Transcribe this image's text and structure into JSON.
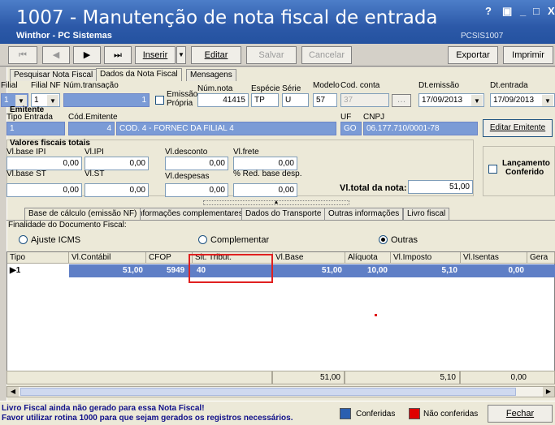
{
  "window": {
    "title": "1007 - Manutenção de nota fiscal de entrada",
    "company": "Winthor - PC Sistemas",
    "routine": "PCSIS1007",
    "controls": [
      "?",
      "▣",
      "_",
      "□",
      "X"
    ]
  },
  "toolbar": {
    "insert": "Inserir",
    "edit": "Editar",
    "save": "Salvar",
    "cancel": "Cancelar",
    "export": "Exportar",
    "print": "Imprimir"
  },
  "tabs": {
    "search": "Pesquisar Nota Fiscal",
    "data": "Dados da Nota Fiscal",
    "messages": "Mensagens"
  },
  "header": {
    "filial_label": "Filial",
    "filial_value": "1",
    "filial_nf_label": "Filial NF",
    "filial_nf_value": "1",
    "transacao_label": "Núm.transação",
    "transacao_value": "1",
    "emissao_propria_label_1": "Emissão",
    "emissao_propria_label_2": "Própria",
    "num_nota_label": "Núm.nota",
    "num_nota_value": "41415",
    "especie_label": "Espécie",
    "especie_value": "TP",
    "serie_label": "Série",
    "serie_value": "U",
    "modelo_label": "Modelo",
    "modelo_value": "57",
    "cod_conta_label": "Cod. conta",
    "cod_conta_value": "37",
    "dt_emissao_label": "Dt.emissão",
    "dt_emissao_value": "17/09/2013",
    "dt_entrada_label": "Dt.entrada",
    "dt_entrada_value": "17/09/2013"
  },
  "emitente": {
    "section": "Emitente",
    "tipo_entrada_label": "Tipo Entrada",
    "tipo_entrada_value": "1",
    "cod_label": "Cód.Emitente",
    "cod_value": "4",
    "nome_value": "COD. 4 - FORNEC DA FILIAL 4",
    "uf_label": "UF",
    "uf_value": "GO",
    "cnpj_label": "CNPJ",
    "cnpj_value": "06.177.710/0001-78",
    "edit_button": "Editar Emitente"
  },
  "valores": {
    "section": "Valores fiscais totais",
    "base_ipi_label": "Vl.base IPI",
    "base_ipi_value": "0,00",
    "ipi_label": "Vl.IPI",
    "ipi_value": "0,00",
    "desconto_label": "Vl.desconto",
    "desconto_value": "0,00",
    "frete_label": "Vl.frete",
    "frete_value": "0,00",
    "base_st_label": "Vl.base ST",
    "base_st_value": "0,00",
    "st_label": "Vl.ST",
    "st_value": "0,00",
    "despesas_label": "Vl.despesas",
    "despesas_value": "0,00",
    "red_base_label": "% Red. base desp.",
    "red_base_value": "0,00",
    "total_label": "Vl.total da nota:",
    "total_value": "51,00",
    "lancamento_1": "Lançamento",
    "lancamento_2": "Conferido"
  },
  "subtabs": {
    "base": "Base de cálculo (emissão NF)",
    "info": "Informações complementares",
    "transporte": "Dados do Transporte",
    "outras": "Outras informações",
    "livro": "Livro fiscal"
  },
  "finalidade": {
    "label": "Finalidade do Documento Fiscal:",
    "ajuste": "Ajuste ICMS",
    "complementar": "Complementar",
    "outras": "Outras"
  },
  "grid": {
    "headers": [
      "Tipo",
      "Vl.Contábil",
      "CFOP",
      "Sit. Tribut.",
      "Vl.Base",
      "Alíquota",
      "Vl.Imposto",
      "Vl.Isentas",
      "Gera"
    ],
    "row": {
      "tipo": "1",
      "contabil": "51,00",
      "cfop": "5949",
      "sit": "40",
      "base": "51,00",
      "aliquota": "10,00",
      "imposto": "5,10",
      "isentas": "0,00"
    },
    "footer": {
      "base": "51,00",
      "imposto": "5,10",
      "isentas": "0,00"
    }
  },
  "status": {
    "line1": "Livro Fiscal ainda não gerado para essa Nota Fiscal!",
    "line2": "Favor utilizar rotina 1000 para que sejam gerados os registros necessários.",
    "conferidas": "Conferidas",
    "nao_conferidas": "Não conferidas",
    "close": "Fechar",
    "color_conferidas": "#2b5fb0",
    "color_nao": "#e00000"
  }
}
